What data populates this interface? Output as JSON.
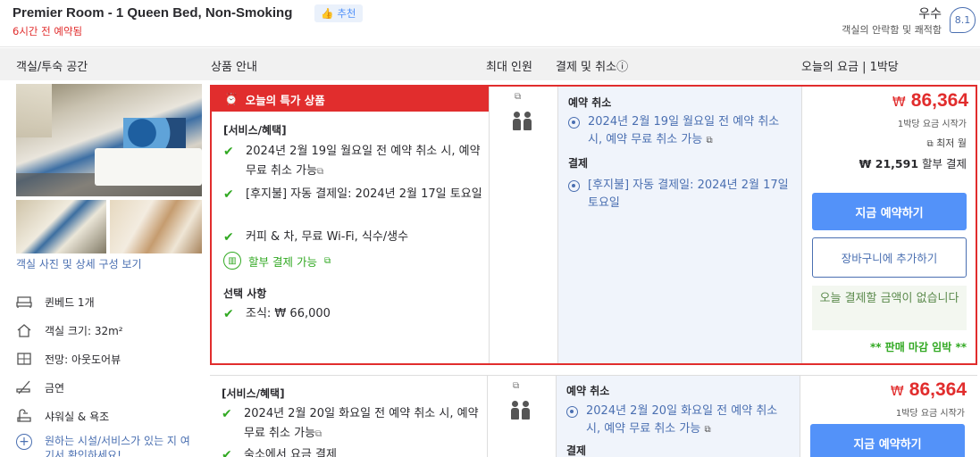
{
  "header": {
    "room_title": "Premier Room - 1 Queen Bed, Non-Smoking",
    "recommend_label": "추천",
    "booked_text": "6시간 전 예약됨",
    "rating_word": "우수",
    "rating_sub": "객실의 안락함 및 쾌적함",
    "rating_score": "8.1"
  },
  "columns": {
    "room": "객실/투숙 공간",
    "product": "상품 안내",
    "guests": "최대 인원",
    "payment": "결제 및 취소ⓘ",
    "price": "오늘의 요금 | 1박당"
  },
  "room": {
    "photo_link": "객실 사진 및 상세 구성 보기",
    "features": [
      {
        "icon": "bed-icon",
        "label": "퀸베드 1개"
      },
      {
        "icon": "house-icon",
        "label": "객실 크기: 32m²"
      },
      {
        "icon": "window-icon",
        "label": "전망: 아웃도어뷰"
      },
      {
        "icon": "no-smoking-icon",
        "label": "금연"
      },
      {
        "icon": "shower-icon",
        "label": "샤워실 & 욕조"
      }
    ],
    "more_link": "원하는 시설/서비스가 있는 지 여기서 확인하세요!"
  },
  "offer1": {
    "deal_banner": "오늘의 특가 상품",
    "services_title": "[서비스/혜택]",
    "benefits": [
      "2024년 2월 19일 월요일 전 예약 취소 시, 예약 무료 취소 가능",
      "[후지불] 자동 결제일: 2024년 2월 17일 토요일",
      "커피 & 차, 무료 Wi-Fi, 식수/생수"
    ],
    "installment": "할부 결제 가능",
    "options_title": "선택 사항",
    "option": "조식: ₩ 66,000",
    "cancel_title": "예약 취소",
    "cancel_text": "2024년 2월 19일 월요일 전 예약 취소 시, 예약 무료 취소 가능",
    "pay_title": "결제",
    "pay_text": "[후지불] 자동 결제일: 2024년 2월 17일 토요일",
    "currency": "₩",
    "price": "86,364",
    "price_note": "1박당 요금 시작가",
    "lowest_label": "최저 월",
    "monthly_amount": "₩ 21,591",
    "monthly_suffix": "할부 결제",
    "book_button": "지금 예약하기",
    "cart_button": "장바구니에 추가하기",
    "pay_today": "오늘 결제할 금액이 없습니다",
    "soldout": "** 판매 마감 임박 **"
  },
  "offer2": {
    "services_title": "[서비스/혜택]",
    "benefits": [
      "2024년 2월 20일 화요일 전 예약 취소 시, 예약 무료 취소 가능",
      "숙소에서 요금 결제"
    ],
    "cancel_title": "예약 취소",
    "cancel_text": "2024년 2월 20일 화요일 전 예약 취소 시, 예약 무료 취소 가능",
    "pay_title": "결제",
    "currency": "₩",
    "price": "86,364",
    "price_note": "1박당 요금 시작가",
    "book_button": "지금 예약하기"
  },
  "colors": {
    "accent": "#5392f9",
    "link": "#4a6fb1",
    "deal_red": "#e12d2d",
    "green": "#32a923"
  }
}
